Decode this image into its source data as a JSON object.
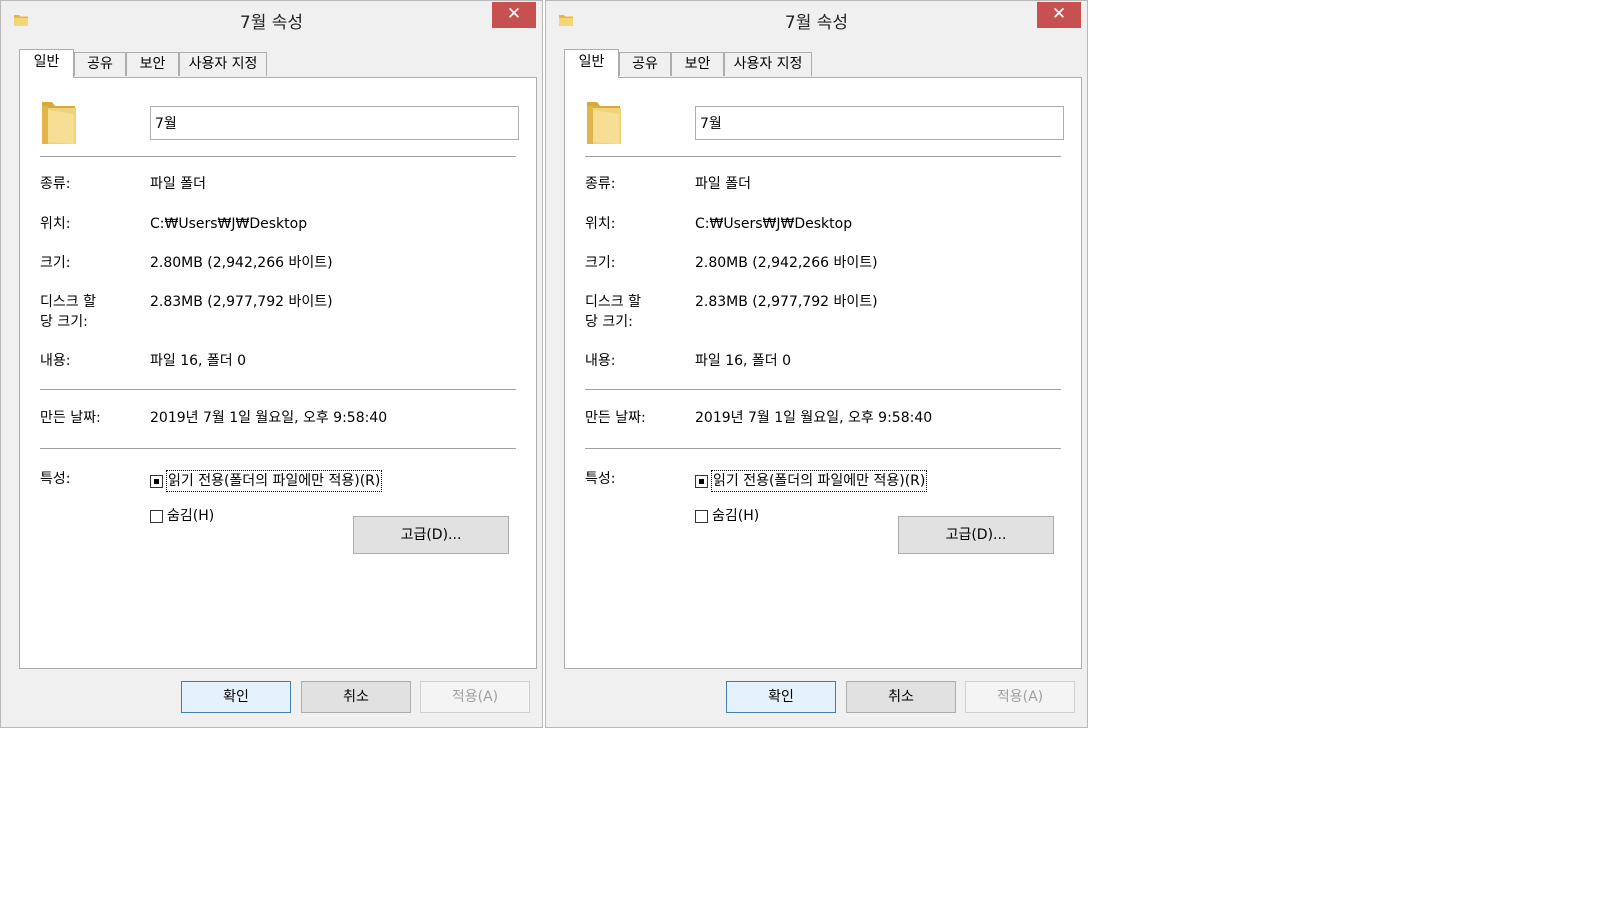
{
  "dialogs": [
    {
      "title": "7월 속성",
      "close_glyph": "✕",
      "tabs": [
        {
          "label": "일반"
        },
        {
          "label": "공유"
        },
        {
          "label": "보안"
        },
        {
          "label": "사용자 지정"
        }
      ],
      "folder_name": "7월",
      "props": {
        "type_label": "종류:",
        "type_value": "파일 폴더",
        "location_label": "위치:",
        "location_value": "C:₩Users₩J₩Desktop",
        "size_label": "크기:",
        "size_value": "2.80MB (2,942,266 바이트)",
        "disk_label_1": "디스크 할",
        "disk_label_2": "당 크기:",
        "disk_value": "2.83MB (2,977,792 바이트)",
        "contents_label": "내용:",
        "contents_value": "파일 16, 폴더 0",
        "created_label": "만든 날짜:",
        "created_value": "2019년 7월 1일 월요일, 오후 9:58:40",
        "attributes_label": "특성:",
        "readonly_label": "읽기 전용(폴더의 파일에만 적용)(R)",
        "readonly_state": "indeterminate",
        "hidden_label": "숨김(H)",
        "hidden_state": "unchecked",
        "advanced_label": "고급(D)..."
      },
      "buttons": {
        "ok": "확인",
        "cancel": "취소",
        "apply": "적용(A)"
      }
    },
    {
      "title": "7월 속성",
      "close_glyph": "✕",
      "tabs": [
        {
          "label": "일반"
        },
        {
          "label": "공유"
        },
        {
          "label": "보안"
        },
        {
          "label": "사용자 지정"
        }
      ],
      "folder_name": "7월",
      "props": {
        "type_label": "종류:",
        "type_value": "파일 폴더",
        "location_label": "위치:",
        "location_value": "C:₩Users₩J₩Desktop",
        "size_label": "크기:",
        "size_value": "2.80MB (2,942,266 바이트)",
        "disk_label_1": "디스크 할",
        "disk_label_2": "당 크기:",
        "disk_value": "2.83MB (2,977,792 바이트)",
        "contents_label": "내용:",
        "contents_value": "파일 16, 폴더 0",
        "created_label": "만든 날짜:",
        "created_value": "2019년 7월 1일 월요일, 오후 9:58:40",
        "attributes_label": "특성:",
        "readonly_label": "읽기 전용(폴더의 파일에만 적용)(R)",
        "readonly_state": "indeterminate",
        "hidden_label": "숨김(H)",
        "hidden_state": "unchecked",
        "advanced_label": "고급(D)..."
      },
      "buttons": {
        "ok": "확인",
        "cancel": "취소",
        "apply": "적용(A)"
      }
    }
  ],
  "colors": {
    "close_button": "#c75050",
    "dialog_bg": "#f0f0f0",
    "default_button_border": "#3c7fb1",
    "folder_yellow": "#f2cf6a"
  },
  "icons": {
    "title_icon": "folder-icon",
    "large_icon": "folder-icon",
    "close": "close-icon"
  }
}
